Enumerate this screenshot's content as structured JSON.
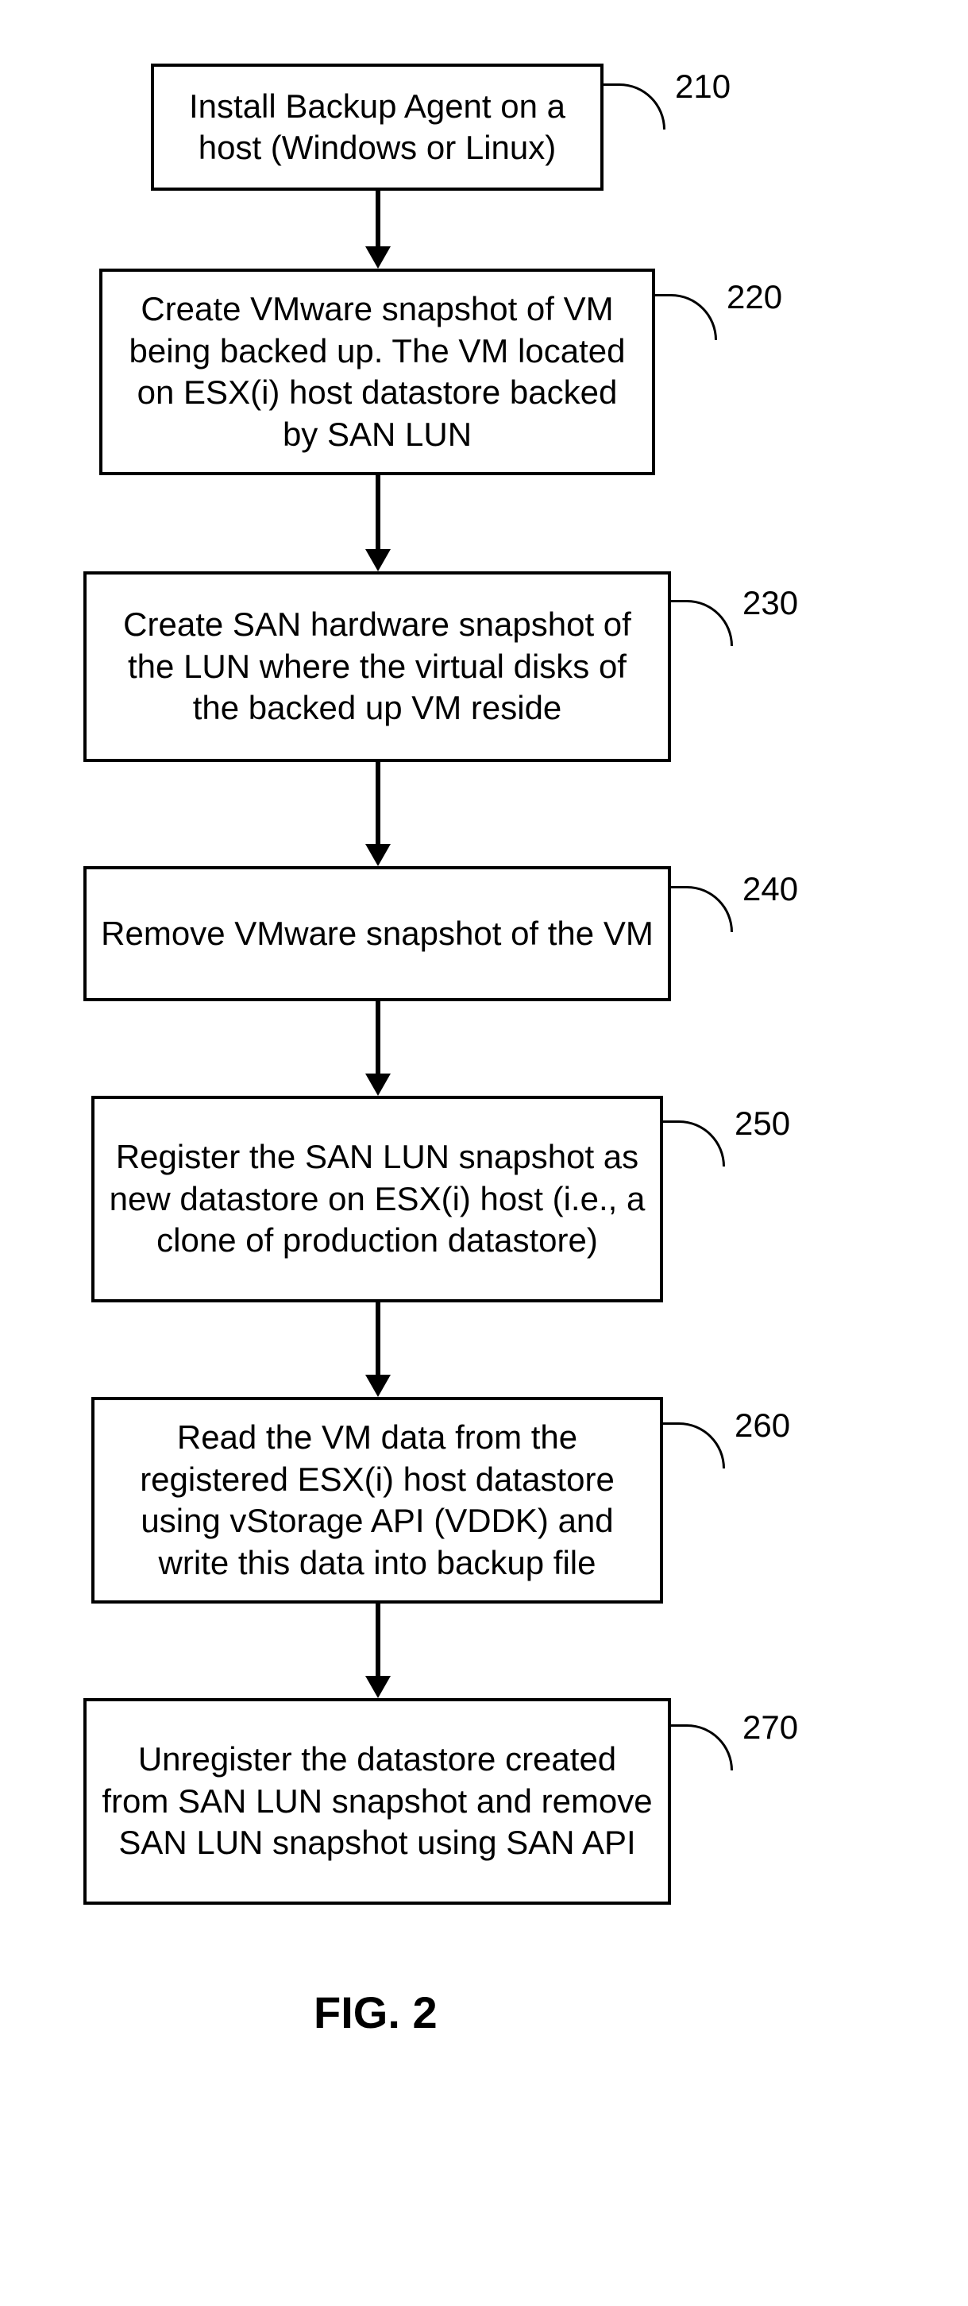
{
  "chart_data": {
    "type": "flowchart",
    "title": "FIG. 2",
    "nodes": [
      {
        "id": "210",
        "label": "Install Backup Agent on a host (Windows or Linux)"
      },
      {
        "id": "220",
        "label": "Create VMware snapshot of VM being backed up.  The VM located on ESX(i) host datastore backed by SAN LUN"
      },
      {
        "id": "230",
        "label": "Create SAN hardware snapshot of the LUN where the virtual disks of the backed up VM reside"
      },
      {
        "id": "240",
        "label": "Remove VMware snapshot of the VM"
      },
      {
        "id": "250",
        "label": "Register the SAN LUN snapshot as new datastore on ESX(i) host (i.e., a clone of production datastore)"
      },
      {
        "id": "260",
        "label": "Read the VM data from the registered ESX(i) host datastore using vStorage API (VDDK) and write this data into backup file"
      },
      {
        "id": "270",
        "label": "Unregister the datastore created from SAN LUN snapshot and remove SAN LUN snapshot using SAN API"
      }
    ],
    "edges": [
      {
        "from": "210",
        "to": "220"
      },
      {
        "from": "220",
        "to": "230"
      },
      {
        "from": "230",
        "to": "240"
      },
      {
        "from": "240",
        "to": "250"
      },
      {
        "from": "250",
        "to": "260"
      },
      {
        "from": "260",
        "to": "270"
      }
    ]
  },
  "steps": {
    "s210": {
      "text": "Install Backup Agent on a host (Windows or Linux)",
      "ref": "210"
    },
    "s220": {
      "text": "Create VMware snapshot of VM being backed up.  The VM located on ESX(i) host datastore backed by SAN LUN",
      "ref": "220"
    },
    "s230": {
      "text": "Create SAN hardware snapshot of the LUN where the virtual disks of the backed up VM reside",
      "ref": "230"
    },
    "s240": {
      "text": "Remove VMware snapshot of the VM",
      "ref": "240"
    },
    "s250": {
      "text": "Register the SAN LUN snapshot as new datastore on ESX(i) host (i.e., a clone of production datastore)",
      "ref": "250"
    },
    "s260": {
      "text": "Read the VM data from the registered ESX(i) host datastore using vStorage API (VDDK) and write this data into backup file",
      "ref": "260"
    },
    "s270": {
      "text": "Unregister the datastore created from SAN LUN snapshot and remove SAN LUN snapshot using SAN API",
      "ref": "270"
    }
  },
  "figure_label": "FIG. 2"
}
